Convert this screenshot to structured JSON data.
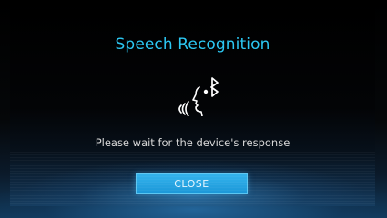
{
  "dialog": {
    "title": "Speech Recognition",
    "message": "Please wait for the device's response",
    "close_label": "CLOSE",
    "icon": "speech-bluetooth-icon"
  },
  "colors": {
    "title": "#2cc7f2",
    "button": "#1b97d8",
    "message": "#d8d8d8"
  }
}
